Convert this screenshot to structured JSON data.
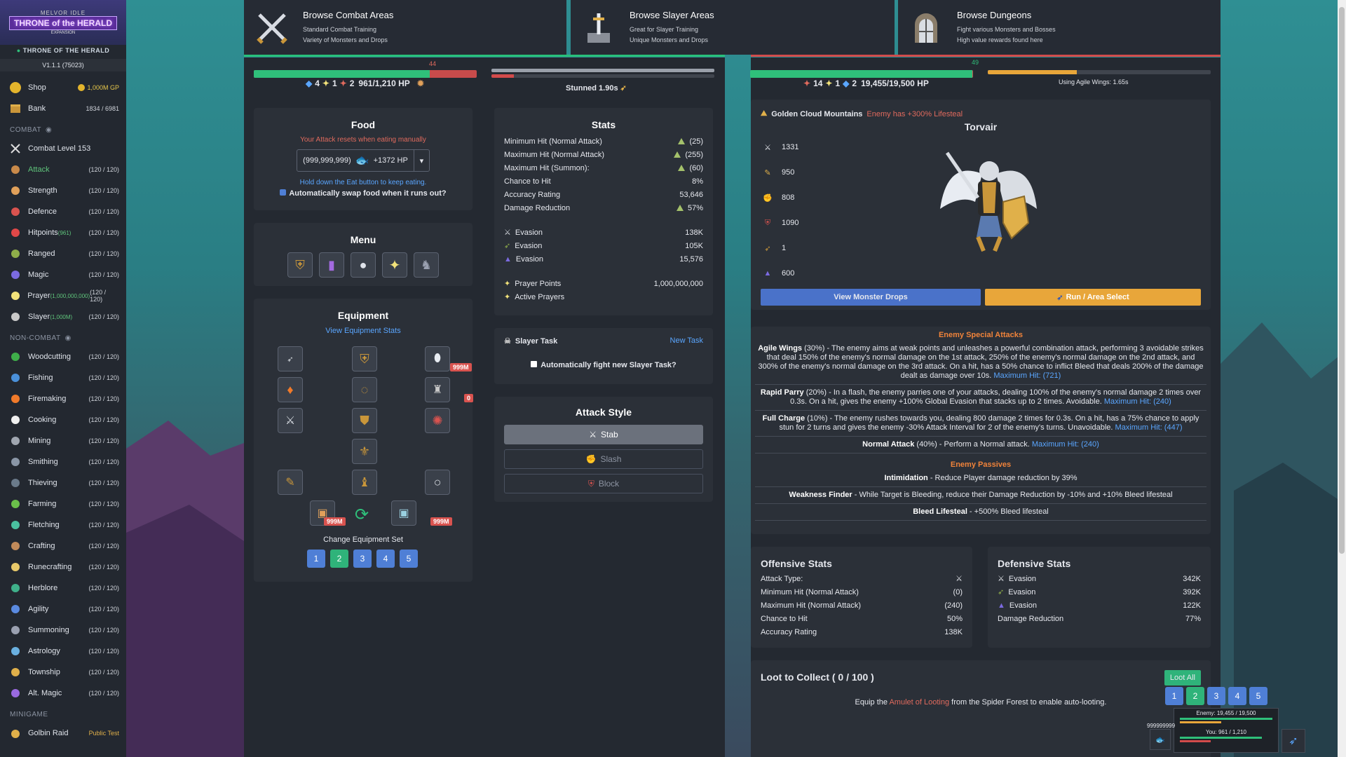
{
  "app": {
    "logo_top": "MELVOR IDLE",
    "logo_main": "THRONE of the HERALD",
    "logo_sub": "EXPANSION",
    "expansion": "THRONE OF THE HERALD",
    "version": "V1.1.1 (75023)"
  },
  "sidebar": {
    "shop": {
      "label": "Shop",
      "gp": "1,000M GP"
    },
    "bank": {
      "label": "Bank",
      "count": "1834 / 6981"
    },
    "combat_header": "COMBAT",
    "combat_level": "Combat Level 153",
    "combat": [
      {
        "label": "Attack",
        "count": "(120 / 120)",
        "color": "#c98a4a"
      },
      {
        "label": "Strength",
        "count": "(120 / 120)",
        "color": "#e0a05a"
      },
      {
        "label": "Defence",
        "count": "(120 / 120)",
        "color": "#d9534f"
      },
      {
        "label": "Hitpoints",
        "sub": "(961)",
        "count": "(120 / 120)",
        "color": "#e04848"
      },
      {
        "label": "Ranged",
        "count": "(120 / 120)",
        "color": "#8fae4a"
      },
      {
        "label": "Magic",
        "count": "(120 / 120)",
        "color": "#7b6ae0"
      },
      {
        "label": "Prayer",
        "sub": "(1,000,000,000)",
        "count": "(120 / 120)",
        "color": "#f2e27a"
      },
      {
        "label": "Slayer",
        "sub": "(1,000M)",
        "count": "(120 / 120)",
        "color": "#c9c9c9"
      }
    ],
    "noncombat_header": "NON-COMBAT",
    "noncombat": [
      {
        "label": "Woodcutting",
        "count": "(120 / 120)",
        "color": "#3fae4a"
      },
      {
        "label": "Fishing",
        "count": "(120 / 120)",
        "color": "#4a90d9"
      },
      {
        "label": "Firemaking",
        "count": "(120 / 120)",
        "color": "#f07a2a"
      },
      {
        "label": "Cooking",
        "count": "(120 / 120)",
        "color": "#f0f0f0"
      },
      {
        "label": "Mining",
        "count": "(120 / 120)",
        "color": "#a0a6b0"
      },
      {
        "label": "Smithing",
        "count": "(120 / 120)",
        "color": "#8a96a6"
      },
      {
        "label": "Thieving",
        "count": "(120 / 120)",
        "color": "#6a7a8a"
      },
      {
        "label": "Farming",
        "count": "(120 / 120)",
        "color": "#6ac04a"
      },
      {
        "label": "Fletching",
        "count": "(120 / 120)",
        "color": "#4ac0a0"
      },
      {
        "label": "Crafting",
        "count": "(120 / 120)",
        "color": "#c08a5a"
      },
      {
        "label": "Runecrafting",
        "count": "(120 / 120)",
        "color": "#e8c96a"
      },
      {
        "label": "Herblore",
        "count": "(120 / 120)",
        "color": "#3fb08a"
      },
      {
        "label": "Agility",
        "count": "(120 / 120)",
        "color": "#5a8ae0"
      },
      {
        "label": "Summoning",
        "count": "(120 / 120)",
        "color": "#9aa0b0"
      },
      {
        "label": "Astrology",
        "count": "(120 / 120)",
        "color": "#6ab0e0"
      },
      {
        "label": "Township",
        "count": "(120 / 120)",
        "color": "#e0b04a"
      },
      {
        "label": "Alt. Magic",
        "count": "(120 / 120)",
        "color": "#9a6ae0"
      }
    ],
    "minigame_header": "MINIGAME",
    "golbin": {
      "label": "Golbin Raid",
      "tag": "Public Test"
    }
  },
  "tabs": [
    {
      "title": "Browse Combat Areas",
      "l1": "Standard Combat Training",
      "l2": "Variety of Monsters and Drops"
    },
    {
      "title": "Browse Slayer Areas",
      "l1": "Great for Slayer Training",
      "l2": "Unique Monsters and Drops"
    },
    {
      "title": "Browse Dungeons",
      "l1": "Fight various Monsters and Bosses",
      "l2": "High value rewards found here"
    }
  ],
  "player": {
    "hp_text": "961/1,210 HP",
    "hp_frac": 0.79,
    "hit": "44",
    "buff1": "4",
    "buff2": "1",
    "buff3": "2",
    "stun_text": "Stunned 1.90s",
    "stun_frac": 0.1
  },
  "food": {
    "title": "Food",
    "warning": "Your Attack resets when eating manually",
    "qty": "(999,999,999)",
    "heal": "+1372 HP",
    "hint": "Hold down the Eat button to keep eating.",
    "swap": "Automatically swap food when it runs out?"
  },
  "menu": {
    "title": "Menu"
  },
  "equipment": {
    "title": "Equipment",
    "view": "View Equipment Stats",
    "b1": "999M",
    "b2": "0",
    "b3": "999M",
    "b4": "999M",
    "change": "Change Equipment Set",
    "sets": [
      "1",
      "2",
      "3",
      "4",
      "5"
    ]
  },
  "stats": {
    "title": "Stats",
    "rows": [
      {
        "label": "Minimum Hit (Normal Attack)",
        "value": "(25)",
        "tri": true
      },
      {
        "label": "Maximum Hit (Normal Attack)",
        "value": "(255)",
        "tri": true
      },
      {
        "label": "Maximum Hit (Summon):",
        "value": "(60)",
        "tri": true
      },
      {
        "label": "Chance to Hit",
        "value": "8%"
      },
      {
        "label": "Accuracy Rating",
        "value": "53,646"
      },
      {
        "label": "Damage Reduction",
        "value": "57%",
        "tri": true
      }
    ],
    "evasion": [
      {
        "label": "Evasion",
        "value": "138K"
      },
      {
        "label": "Evasion",
        "value": "105K"
      },
      {
        "label": "Evasion",
        "value": "15,576"
      }
    ],
    "prayer_points": {
      "label": "Prayer Points",
      "value": "1,000,000,000"
    },
    "active_prayers": "Active Prayers"
  },
  "slayer": {
    "title": "Slayer Task",
    "new": "New Task",
    "auto": "Automatically fight new Slayer Task?"
  },
  "attack_style": {
    "title": "Attack Style",
    "options": [
      "Stab",
      "Slash",
      "Block"
    ]
  },
  "enemy": {
    "hp_text": "19,455/19,500 HP",
    "hp_frac": 0.997,
    "hit": "49",
    "buff1": "14",
    "buff2": "1",
    "buff3": "2",
    "agile": "Using Agile Wings: 1.65s",
    "agile_frac": 0.4,
    "area": "Golden Cloud Mountains",
    "area_mod": "Enemy has +300% Lifesteal",
    "name": "Torvair",
    "stats": [
      "1331",
      "950",
      "808",
      "1090",
      "1",
      "600"
    ],
    "drops_btn": "View Monster Drops",
    "run_btn": "Run / Area Select"
  },
  "specials": {
    "header": "Enemy Special Attacks",
    "items": [
      {
        "name": "Agile Wings",
        "pct": "(30%)",
        "desc": " - The enemy aims at weak points and unleashes a powerful combination attack, performing 3 avoidable strikes that deal 150% of the enemy's normal damage on the 1st attack, 250% of the enemy's normal damage on the 2nd attack, and 300% of the enemy's normal damage on the 3rd attack. On a hit, has a 50% chance to inflict Bleed that deals 200% of the damage dealt as damage over 10s.",
        "max": "Maximum Hit: (721)"
      },
      {
        "name": "Rapid Parry",
        "pct": "(20%)",
        "desc": " - In a flash, the enemy parries one of your attacks, dealing 100% of the enemy's normal damage 2 times over 0.3s. On a hit, gives the enemy +100% Global Evasion that stacks up to 2 times. Avoidable.",
        "max": "Maximum Hit: (240)"
      },
      {
        "name": "Full Charge",
        "pct": "(10%)",
        "desc": " - The enemy rushes towards you, dealing 800 damage 2 times for 0.3s. On a hit, has a 75% chance to apply stun for 2 turns and gives the enemy -30% Attack Interval for 2 of the enemy's turns. Unavoidable.",
        "max": "Maximum Hit: (447)"
      },
      {
        "name": "Normal Attack",
        "pct": "(40%)",
        "desc": " - Perform a Normal attack.",
        "max": "Maximum Hit: (240)"
      }
    ],
    "passives_header": "Enemy Passives",
    "passives": [
      {
        "name": "Intimidation",
        "desc": " - Reduce Player damage reduction by 39%"
      },
      {
        "name": "Weakness Finder",
        "desc": " - While Target is Bleeding, reduce their Damage Reduction by -10% and +10% Bleed lifesteal"
      },
      {
        "name": "Bleed Lifesteal",
        "desc": " - +500% Bleed lifesteal"
      }
    ]
  },
  "offensive": {
    "title": "Offensive Stats",
    "rows": [
      {
        "label": "Attack Type:",
        "value": ""
      },
      {
        "label": "Minimum Hit (Normal Attack)",
        "value": "(0)"
      },
      {
        "label": "Maximum Hit (Normal Attack)",
        "value": "(240)"
      },
      {
        "label": "Chance to Hit",
        "value": "50%"
      },
      {
        "label": "Accuracy Rating",
        "value": "138K"
      }
    ]
  },
  "defensive": {
    "title": "Defensive Stats",
    "rows": [
      {
        "label": "Evasion",
        "value": "342K"
      },
      {
        "label": "Evasion",
        "value": "392K"
      },
      {
        "label": "Evasion",
        "value": "122K"
      },
      {
        "label": "Damage Reduction",
        "value": "77%"
      }
    ]
  },
  "loot": {
    "title": "Loot to Collect ( 0 / 100 )",
    "loot_all": "Loot All",
    "pre": "Equip the ",
    "link": "Amulet of Looting",
    "post": " from the Spider Forest to enable auto-looting."
  },
  "mini": {
    "sets": [
      "1",
      "2",
      "3",
      "4",
      "5"
    ],
    "enemy": "Enemy: 19,455 / 19,500",
    "you": "You: 961 / 1,210",
    "qty": "999999999"
  }
}
